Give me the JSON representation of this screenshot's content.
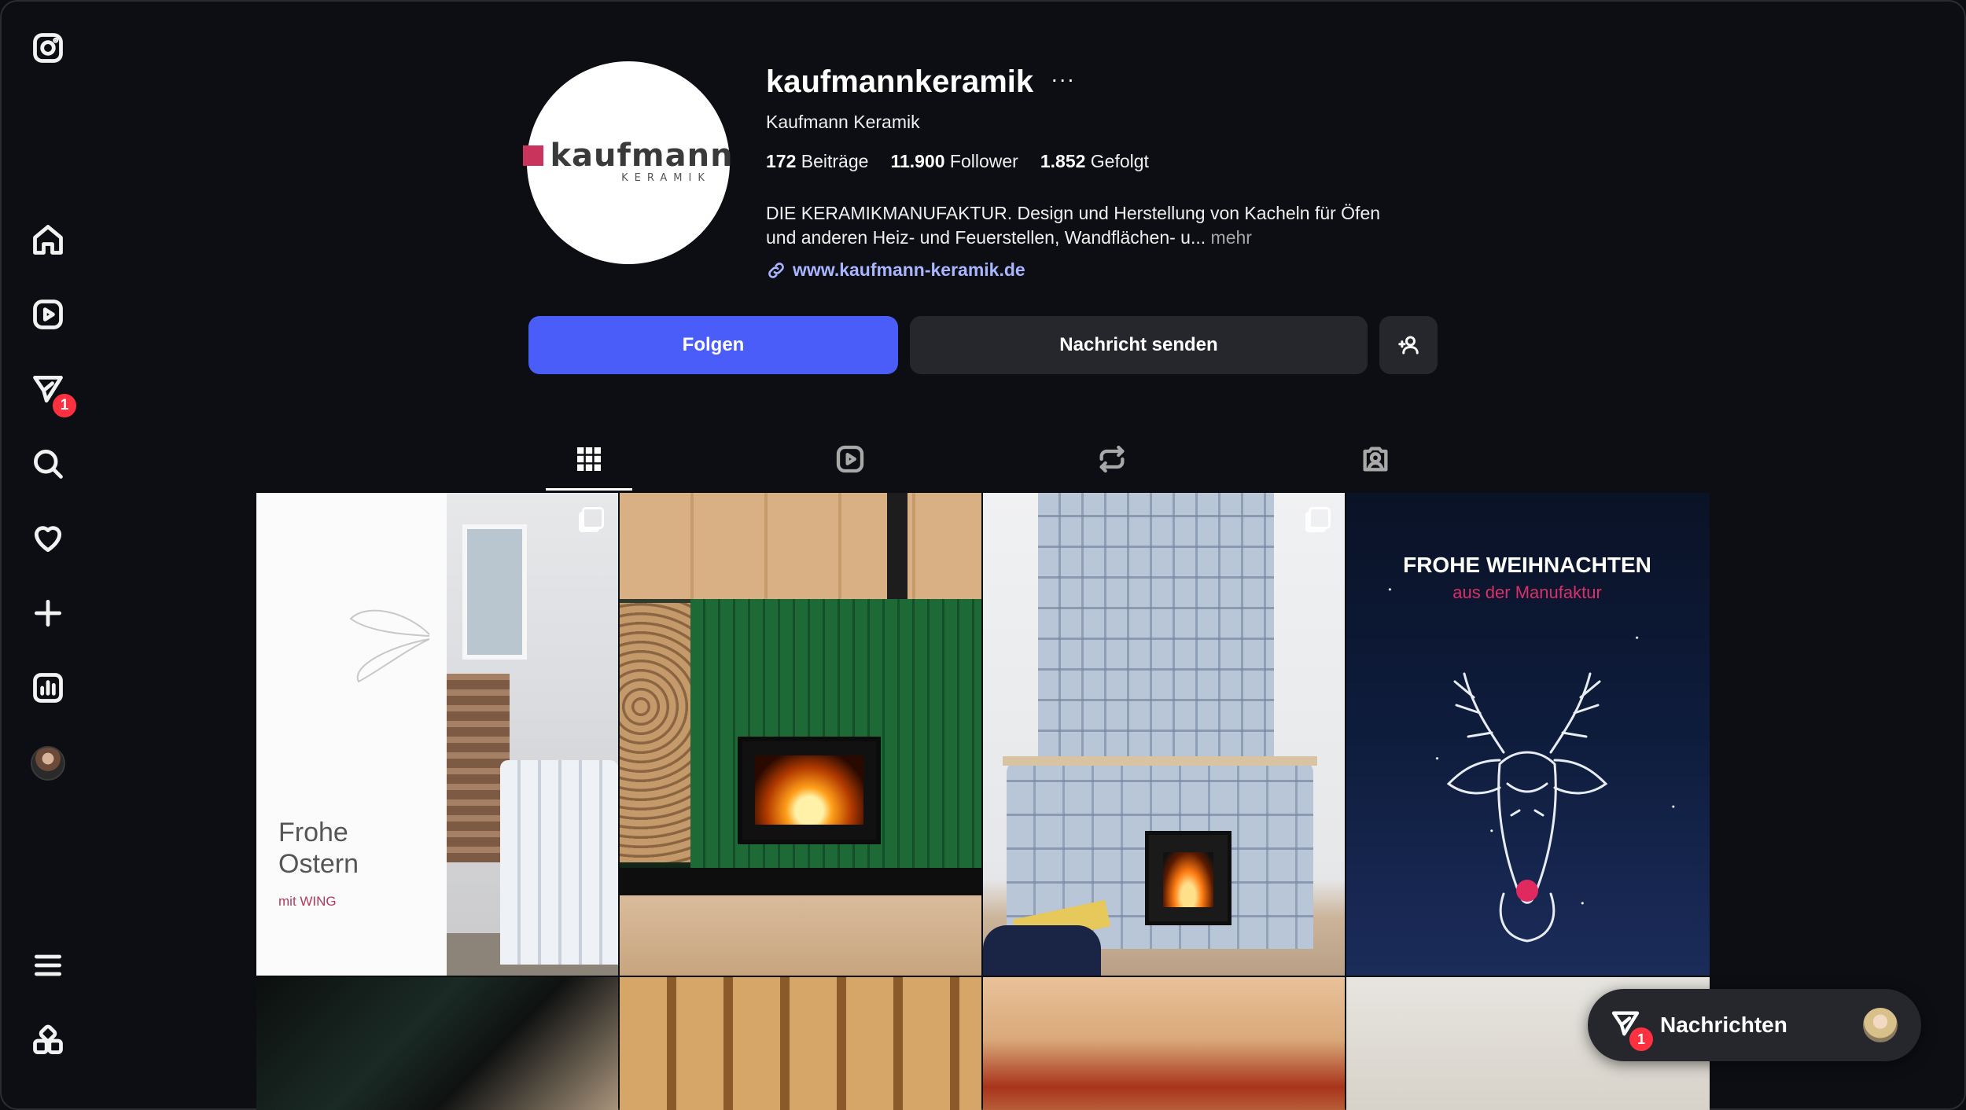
{
  "profile": {
    "username": "kaufmannkeramik",
    "full_name": "Kaufmann Keramik",
    "logo_text": "kaufmann",
    "logo_subtext": "KERAMIK",
    "stats": {
      "posts_count": "172",
      "posts_label": "Beiträge",
      "followers_count": "11.900",
      "followers_label": "Follower",
      "following_count": "1.852",
      "following_label": "Gefolgt"
    },
    "bio_line1": "DIE KERAMIKMANUFAKTUR. Design und Herstellung von Kacheln für Öfen",
    "bio_line2": "und anderen Heiz- und Feuerstellen, Wandflächen- u...",
    "bio_more": "mehr",
    "website": "www.kaufmann-keramik.de",
    "more_options": "···"
  },
  "actions": {
    "follow_label": "Folgen",
    "message_label": "Nachricht senden"
  },
  "sidebar": {
    "items": [
      {
        "name": "instagram-logo-icon"
      },
      {
        "name": "home-icon"
      },
      {
        "name": "reels-icon"
      },
      {
        "name": "messages-icon",
        "badge": "1"
      },
      {
        "name": "search-icon"
      },
      {
        "name": "notifications-heart-icon"
      },
      {
        "name": "create-plus-icon"
      },
      {
        "name": "dashboard-icon"
      },
      {
        "name": "profile-avatar"
      },
      {
        "name": "menu-icon"
      },
      {
        "name": "more-apps-icon"
      }
    ]
  },
  "tabs": [
    {
      "name": "posts-grid-icon",
      "active": true
    },
    {
      "name": "reels-icon",
      "active": false
    },
    {
      "name": "reposts-icon",
      "active": false
    },
    {
      "name": "tagged-icon",
      "active": false
    }
  ],
  "posts": {
    "easter_title_line1": "Frohe",
    "easter_title_line2": "Ostern",
    "easter_subtitle": "mit WING",
    "christmas_title": "FROHE WEIHNACHTEN",
    "christmas_subtitle": "aus der Manufaktur"
  },
  "messages_pill": {
    "label": "Nachrichten",
    "badge": "1"
  },
  "colors": {
    "accent_blue": "#4a5df9",
    "badge_red": "#ff3040",
    "link_blue": "#a9b6ff",
    "brand_pink": "#c8345b"
  }
}
